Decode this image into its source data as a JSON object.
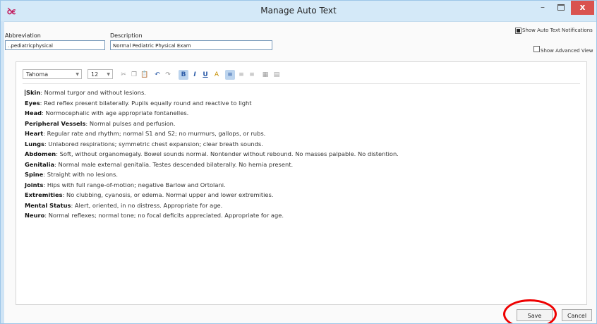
{
  "window": {
    "title": "Manage Auto Text",
    "app_icon": "ꝺꞓ",
    "controls": {
      "minimize": "–",
      "close": "x"
    }
  },
  "form": {
    "abbreviation_label": "Abbreviation",
    "abbreviation_value": "..pediatricphysical",
    "description_label": "Description",
    "description_value": "Normal Pediatric Physical Exam",
    "show_notifications_label": "Show Auto Text Notifications",
    "show_notifications_checked": true,
    "show_advanced_label": "Show Advanced View",
    "show_advanced_checked": false
  },
  "toolbar": {
    "font_name": "Tahoma",
    "font_size": "12",
    "icons": [
      "cut-icon",
      "copy-icon",
      "paste-icon",
      "undo-icon",
      "redo-icon",
      "bold-icon",
      "italic-icon",
      "underline-icon",
      "font-color-icon",
      "align-left-icon",
      "align-center-icon",
      "align-right-icon",
      "spellcheck-icon",
      "table-icon"
    ],
    "bold": "B",
    "italic": "I",
    "underline": "U"
  },
  "content": {
    "lines": [
      {
        "label": "Skin",
        "text": ": Normal turgor and without lesions."
      },
      {
        "label": "Eyes",
        "text": ": Red reflex present bilaterally. Pupils equally round and reactive to light"
      },
      {
        "label": "Head",
        "text": ": Normocephalic with age appropriate fontanelles."
      },
      {
        "label": "Peripheral Vessels",
        "text": ": Normal pulses and perfusion."
      },
      {
        "label": "Heart",
        "text": ": Regular rate and rhythm; normal S1 and S2; no murmurs, gallops, or rubs."
      },
      {
        "label": "Lungs",
        "text": ": Unlabored respirations; symmetric chest expansion; clear breath sounds."
      },
      {
        "label": "Abdomen",
        "text": ": Soft, without organomegaly. Bowel sounds normal. Nontender without rebound. No masses palpable. No distention."
      },
      {
        "label": "Genitalia",
        "text": ": Normal male external genitalia. Testes descended bilaterally. No hernia present."
      },
      {
        "label": "Spine",
        "text": ": Straight with no lesions."
      },
      {
        "label": "Joints",
        "text": ": Hips with full range-of-motion; negative Barlow and Ortolani."
      },
      {
        "label": "Extremities",
        "text": ": No clubbing, cyanosis, or edema. Normal upper and lower extremities."
      },
      {
        "label": "Mental Status",
        "text": ": Alert, oriented, in no distress. Appropriate for age."
      },
      {
        "label": "Neuro",
        "text": ": Normal reflexes; normal tone; no focal deficits appreciated. Appropriate for age."
      }
    ]
  },
  "buttons": {
    "save": "Save",
    "cancel": "Cancel"
  },
  "colors": {
    "titlebar": "#d4e9f8",
    "close": "#d9534f",
    "highlight_circle": "#e00000"
  }
}
